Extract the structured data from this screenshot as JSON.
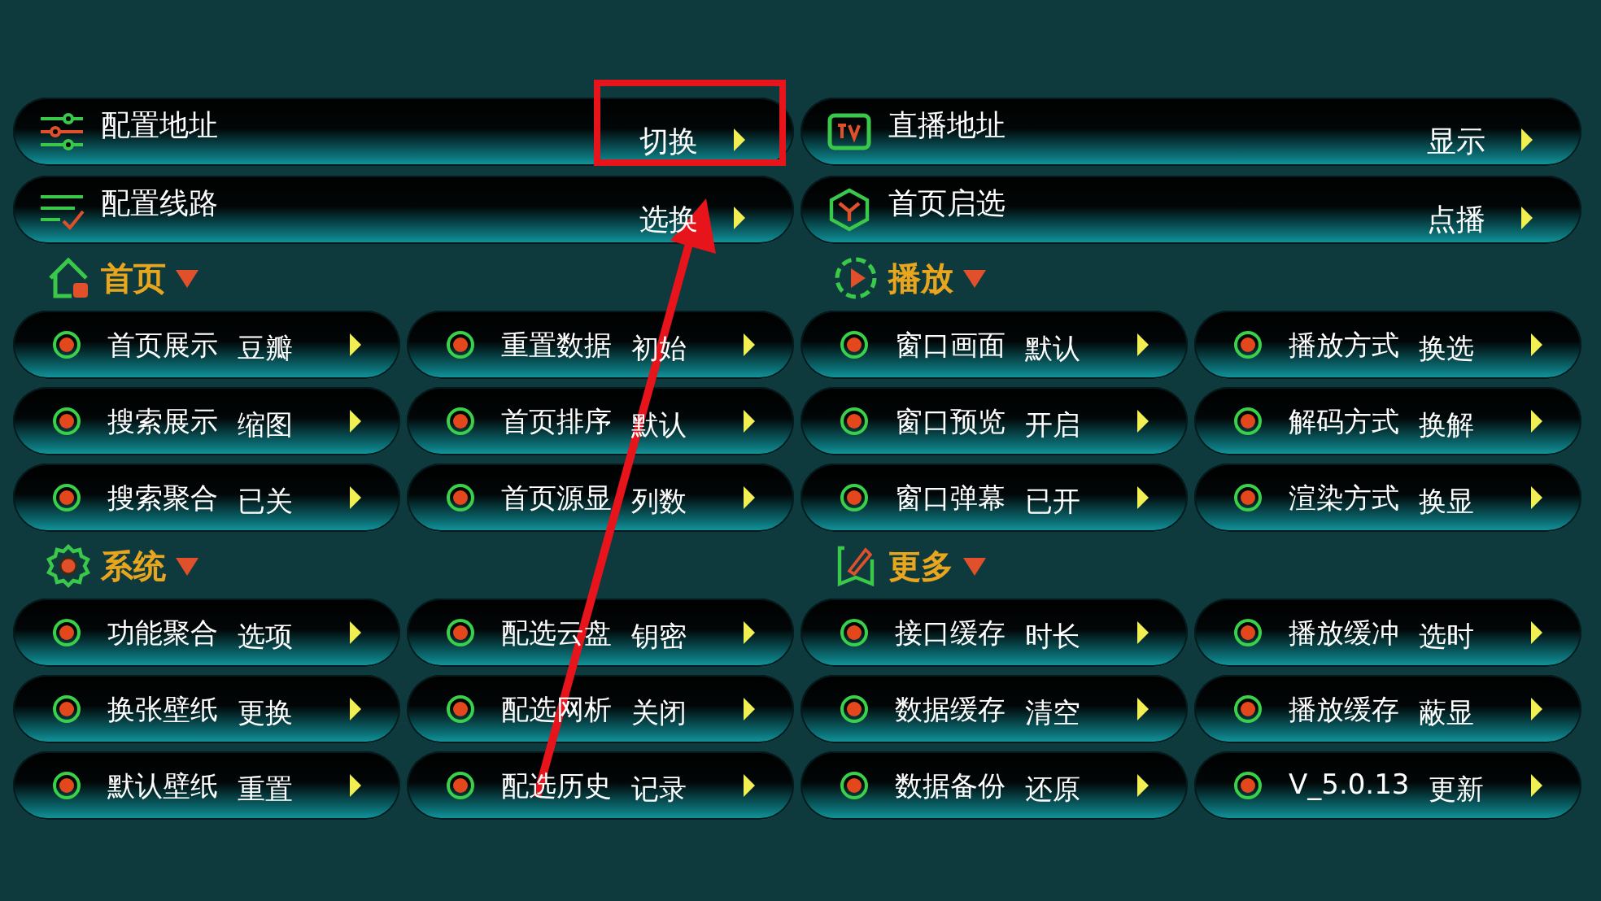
{
  "columns": [
    {
      "top": [
        {
          "kind": "sliders",
          "label": "配置地址",
          "value": "切换",
          "highlighted": true
        },
        {
          "kind": "list-check",
          "label": "配置线路",
          "value": "选换",
          "highlighted": false
        }
      ],
      "sections": [
        {
          "kind": "home",
          "title": "首页",
          "expanded": true,
          "items": [
            {
              "label": "首页展示",
              "value": "豆瓣"
            },
            {
              "label": "重置数据",
              "value": "初始"
            },
            {
              "label": "搜索展示",
              "value": "缩图"
            },
            {
              "label": "首页排序",
              "value": "默认"
            },
            {
              "label": "搜索聚合",
              "value": "已关"
            },
            {
              "label": "首页源显",
              "value": "列数"
            }
          ]
        },
        {
          "kind": "gear",
          "title": "系统",
          "expanded": true,
          "items": [
            {
              "label": "功能聚合",
              "value": "选项"
            },
            {
              "label": "配选云盘",
              "value": "钥密"
            },
            {
              "label": "换张壁纸",
              "value": "更换"
            },
            {
              "label": "配选网析",
              "value": "关闭"
            },
            {
              "label": "默认壁纸",
              "value": "重置"
            },
            {
              "label": "配选历史",
              "value": "记录"
            }
          ]
        }
      ]
    },
    {
      "top": [
        {
          "kind": "tv",
          "label": "直播地址",
          "value": "显示",
          "highlighted": false
        },
        {
          "kind": "hexagon",
          "label": "首页启选",
          "value": "点播",
          "highlighted": false
        }
      ],
      "sections": [
        {
          "kind": "play",
          "title": "播放",
          "expanded": true,
          "items": [
            {
              "label": "窗口画面",
              "value": "默认"
            },
            {
              "label": "播放方式",
              "value": "换选"
            },
            {
              "label": "窗口预览",
              "value": "开启"
            },
            {
              "label": "解码方式",
              "value": "换解"
            },
            {
              "label": "窗口弹幕",
              "value": "已开"
            },
            {
              "label": "渲染方式",
              "value": "换显"
            }
          ]
        },
        {
          "kind": "note",
          "title": "更多",
          "expanded": true,
          "items": [
            {
              "label": "接口缓存",
              "value": "时长"
            },
            {
              "label": "播放缓冲",
              "value": "选时"
            },
            {
              "label": "数据缓存",
              "value": "清空"
            },
            {
              "label": "播放缓存",
              "value": "蔽显"
            },
            {
              "label": "数据备份",
              "value": "还原"
            },
            {
              "label": "V_5.0.13",
              "value": "更新"
            }
          ]
        }
      ]
    }
  ],
  "annotation": {
    "arrow": true
  }
}
